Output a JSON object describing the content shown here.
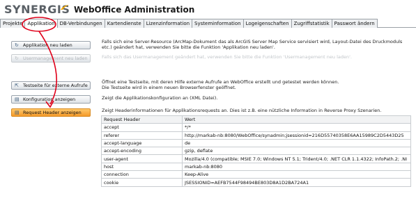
{
  "header": {
    "logo_text": "SYNERGIS",
    "title": "WebOffice Administration"
  },
  "tabs": [
    {
      "label": "Projekte"
    },
    {
      "label": "Applikation"
    },
    {
      "label": "DB-Verbindungen"
    },
    {
      "label": "Kartendienste"
    },
    {
      "label": "Lizenzinformation"
    },
    {
      "label": "Systeminformation"
    },
    {
      "label": "Logeigenschaften"
    },
    {
      "label": "Zugriffstatistik"
    },
    {
      "label": "Passwort ändern"
    }
  ],
  "buttons": {
    "reload_app": "Applikation neu laden",
    "reload_user_mgmt": "Usermanagement neu laden",
    "test_page": "Testseite für externe Aufrufe",
    "config": "Konfiguration anzeigen",
    "request_header": "Request Header anzeigen"
  },
  "descriptions": {
    "reload_app": "Falls sich eine Server-Resource (ArcMap-Dokument das als ArcGIS Server Map Service servisiert wird, Layout-Datei des Druckmoduls etc.) geändert hat, verwenden Sie bitte die Funktion 'Applikation neu laden'.",
    "reload_user_mgmt": "Falls sich das Usermanagement geändert hat, verwenden Sie bitte die Funktion 'Usermanagement neu laden'.",
    "test_page_1": "Öffnet eine Testseite, mit deren Hilfe externe Aufrufe an WebOffice erstellt und getestet werden können.",
    "test_page_2": "Die Testseite wird in einem neuen Browserfenster geöffnet.",
    "config": "Zeigt die Applikationskonfiguration an (XML Datei).",
    "request_header": "Zeigt Headerinformationen für Applikationsrequests an. Dies ist z.B. eine nützliche Information in Reverse Proxy Szenarien."
  },
  "table": {
    "columns": [
      "Request Header",
      "Wert"
    ],
    "rows": [
      [
        "accept",
        "*/*"
      ],
      [
        "referer",
        "http://markab-nb:8080/WebOffice/synadmin;jsessionid=216D55740358E6AA15989C2D5443D25"
      ],
      [
        "accept-language",
        "de"
      ],
      [
        "accept-encoding",
        "gzip, deflate"
      ],
      [
        "user-agent",
        "Mozilla/4.0 (compatible; MSIE 7.0; Windows NT 5.1; Trident/4.0; .NET CLR 1.1.4322; InfoPath.2; .NI"
      ],
      [
        "host",
        "markab-nb:8080"
      ],
      [
        "connection",
        "Keep-Alive"
      ],
      [
        "cookie",
        "JSESSIONID=AEFB7544F98494BE803D8A1D2BA724A1"
      ]
    ]
  },
  "colors": {
    "highlight_button": "#f49a2a",
    "annotation": "#e0001a",
    "logo_swoosh": "#f5a800"
  },
  "icons": {
    "reload_app": "refresh-icon",
    "reload_user_mgmt": "refresh-icon",
    "test_page": "external-link-icon",
    "config": "document-icon",
    "request_header": "document-icon"
  }
}
